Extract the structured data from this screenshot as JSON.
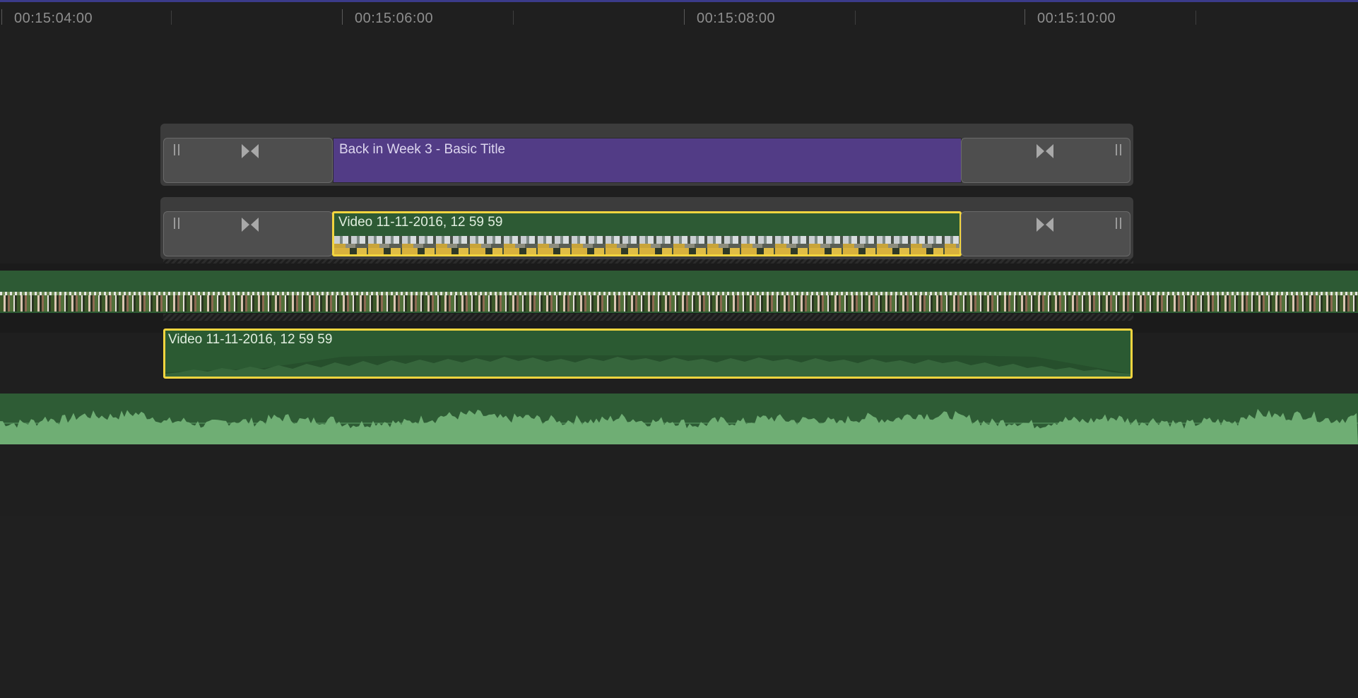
{
  "ruler": {
    "timecodes": [
      "00:15:04:00",
      "00:15:06:00",
      "00:15:08:00",
      "00:15:10:00"
    ]
  },
  "clips": {
    "title_clip": {
      "label": "Back in Week 3 - Basic Title",
      "color": "#523c86"
    },
    "connected_video": {
      "label": "Video 11-11-2016, 12 59 59",
      "color": "#2d5a34"
    },
    "connected_audio": {
      "label": "Video 11-11-2016, 12 59 59",
      "color": "#2b5a32"
    }
  },
  "colors": {
    "selection": "#f3d53f",
    "background": "#1f1f1f",
    "video_green": "#2d5a34",
    "audio_wave": "#6fae74"
  },
  "icons": {
    "trim_handle": "double-bar-icon",
    "transition": "bowtie-icon"
  }
}
